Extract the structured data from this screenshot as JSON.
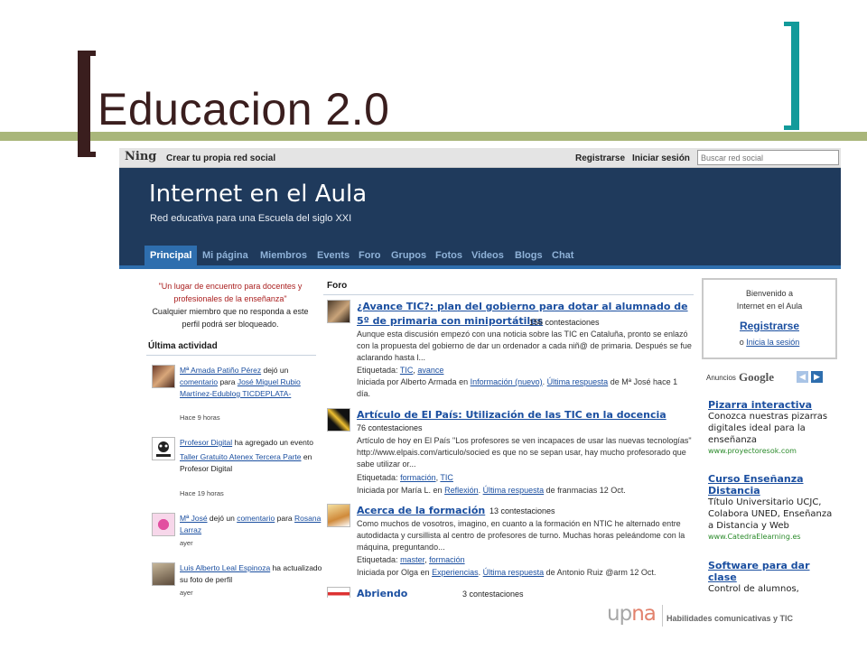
{
  "slide": {
    "title": "Educacion 2.0"
  },
  "ning_bar": {
    "logo": "Ning",
    "create": "Crear tu propia red social",
    "register": "Registrarse",
    "login": "Iniciar sesión",
    "search_placeholder": "Buscar red social"
  },
  "site": {
    "title": "Internet en el Aula",
    "subtitle": "Red educativa para una Escuela del siglo XXI"
  },
  "nav": [
    "Principal",
    "Mi página",
    "Miembros",
    "Events",
    "Foro",
    "Grupos",
    "Fotos",
    "Videos",
    "Blogs",
    "Chat"
  ],
  "left": {
    "quote": "\"Un lugar de encuentro para docentes y profesionales de la enseñanza\"",
    "note": "Cualquier miembro que no responda a este perfil podrá ser bloqueado.",
    "activity_title": "Última actividad",
    "activity": [
      {
        "user": "Mª Amada Patiño Pérez",
        "t1": "dejó un",
        "link2": "comentario",
        "t2": "para",
        "link3": "José Miguel Rubio Martínez-Edublog TICDEPLATA-",
        "time": "Hace 9 horas"
      },
      {
        "user": "Profesor Digital",
        "t1": "ha agregado un evento",
        "link2": "Taller Gratuito Atenex Tercera Parte",
        "t2": "en Profesor Digital",
        "time": "Hace 19 horas"
      },
      {
        "user": "Mª José",
        "t1": "dejó un",
        "link2": "comentario",
        "t2": "para",
        "link3": "Rosana Larraz",
        "time": "ayer"
      },
      {
        "user": "Luis Alberto Leal Espinoza",
        "t1": "ha actualizado su foto de perfil",
        "time": "ayer"
      }
    ]
  },
  "forum": {
    "title": "Foro",
    "items": [
      {
        "title": "¿Avance TIC?: plan del gobierno para dotar al alumnado de 5º de primaria con miniportátiles",
        "count": "156 contestaciones",
        "excerpt": "Aunque esta discusión empezó con una noticia sobre las TIC en Cataluña, pronto se enlazó con la propuesta del gobierno de dar un ordenador a cada niñ@ de primaria. Después se fue aclarando hasta l...",
        "tags_label": "Etiquetada:",
        "tag1": "TIC",
        "tag2": "avance",
        "started_pre": "Iniciada por Alberto Armada en",
        "category": "Información (nuevo)",
        "last_reply": "Última respuesta",
        "last_by": "de Mª José hace 1 día."
      },
      {
        "title": "Artículo de El País: Utilización de las TIC en la docencia",
        "count": "76 contestaciones",
        "excerpt": "Artículo de hoy en El País \"Los profesores se ven incapaces de usar las nuevas tecnologías\" http://www.elpais.com/articulo/socied es que no se sepan usar, hay mucho profesorado que sabe utilizar or...",
        "tags_label": "Etiquetada:",
        "tag1": "formación",
        "tag2": "TIC",
        "started_pre": "Iniciada por María L. en",
        "category": "Reflexión",
        "last_reply": "Última respuesta",
        "last_by": "de franmacias 12 Oct."
      },
      {
        "title": "Acerca de la formación",
        "count": "13 contestaciones",
        "excerpt": "Como muchos de vosotros, imagino, en cuanto a la formación en NTIC he alternado entre autodidacta y cursillista al centro de profesores de turno. Muchas horas peleándome con la máquina, preguntando...",
        "tags_label": "Etiquetada:",
        "tag1": "master",
        "tag2": "formación",
        "started_pre": "Iniciada por Olga en",
        "category": "Experiencias",
        "last_reply": "Última respuesta",
        "last_by": "de Antonio Ruiz @arm 12 Oct."
      },
      {
        "title": "Abriendo caminos",
        "count": "3 contestaciones"
      }
    ]
  },
  "right": {
    "welcome1": "Bienvenido a",
    "welcome2": "Internet en el Aula",
    "register": "Registrarse",
    "or": "o",
    "login": "Inicia la sesión",
    "ads_label": "Anuncios",
    "ads_google": "Google",
    "ads": [
      {
        "title": "Pizarra interactiva",
        "body": "Conozca nuestras pizarras digitales ideal para la enseñanza",
        "url": "www.proyectoresok.com"
      },
      {
        "title": "Curso Enseñanza Distancia",
        "body": "Título Universitario UCJC, Colabora UNED, Enseñanza a Distancia y Web",
        "url": "www.CatedraElearning.es"
      },
      {
        "title": "Software para dar clase",
        "body": "Control de alumnos,"
      }
    ]
  },
  "footer": {
    "logo_up": "up",
    "logo_na": "na",
    "tagline": "Habilidades comunicativas y TIC"
  },
  "colors": {
    "header_bg": "#1f3a5c",
    "nav_active": "#2e6eae",
    "link": "#1b4fa0",
    "quote": "#aa1f1f",
    "bracket_left": "#3a1e1e",
    "bracket_right": "#129a9a",
    "title_rule": "#a9b67a"
  }
}
